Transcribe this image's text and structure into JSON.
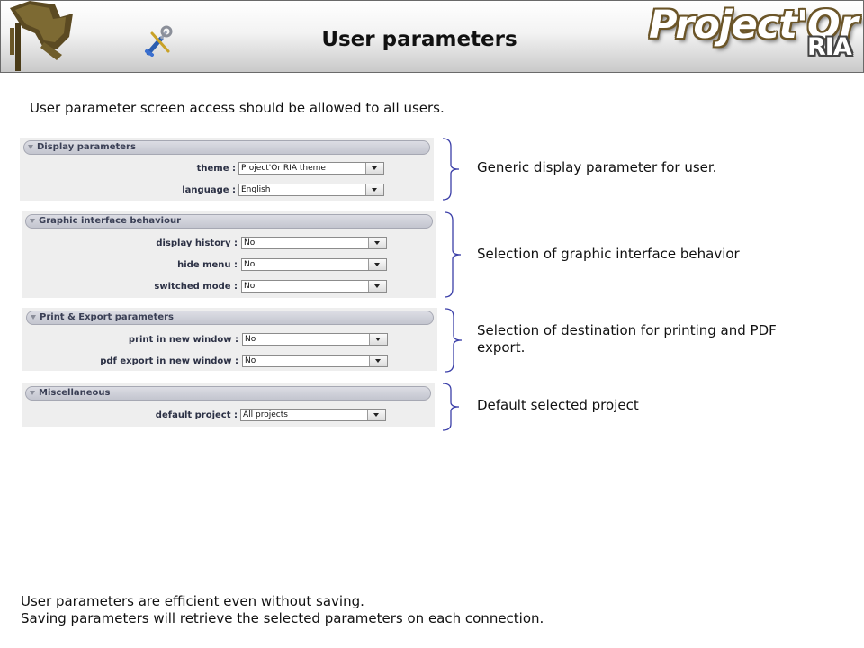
{
  "header": {
    "title": "User parameters",
    "brand_main": "Project'Or",
    "brand_sub": "RIA",
    "colors": {
      "brand_outline": "#6b5528",
      "header_border": "#6a6a6a"
    }
  },
  "intro": "User parameter screen access should be allowed to all users.",
  "panels": [
    {
      "title": "Display parameters",
      "rows": [
        {
          "label": "theme :",
          "value": "Project'Or RIA theme"
        },
        {
          "label": "language :",
          "value": "English"
        }
      ],
      "note": "Generic display parameter for user."
    },
    {
      "title": "Graphic interface behaviour",
      "rows": [
        {
          "label": "display history :",
          "value": "No"
        },
        {
          "label": "hide menu :",
          "value": "No"
        },
        {
          "label": "switched mode :",
          "value": "No"
        }
      ],
      "note": "Selection of graphic interface behavior"
    },
    {
      "title": "Print & Export parameters",
      "rows": [
        {
          "label": "print in new window :",
          "value": "No"
        },
        {
          "label": "pdf export in new window :",
          "value": "No"
        }
      ],
      "note_line1": "Selection of destination for printing and PDF",
      "note_line2": "export."
    },
    {
      "title": "Miscellaneous",
      "rows": [
        {
          "label": "default project :",
          "value": "All projects"
        }
      ],
      "note": "Default selected project"
    }
  ],
  "footer": {
    "line1": "User parameters are efficient even without saving.",
    "line2": "Saving parameters will retrieve the selected parameters on each connection."
  },
  "icons": [
    "projector-logo-icon",
    "tools-icon",
    "chevron-down-icon",
    "brace-icon"
  ],
  "colors": {
    "brace": "#3b3fa8",
    "panel_bg": "#eeeeee",
    "panel_header_text": "#3a3f55"
  }
}
